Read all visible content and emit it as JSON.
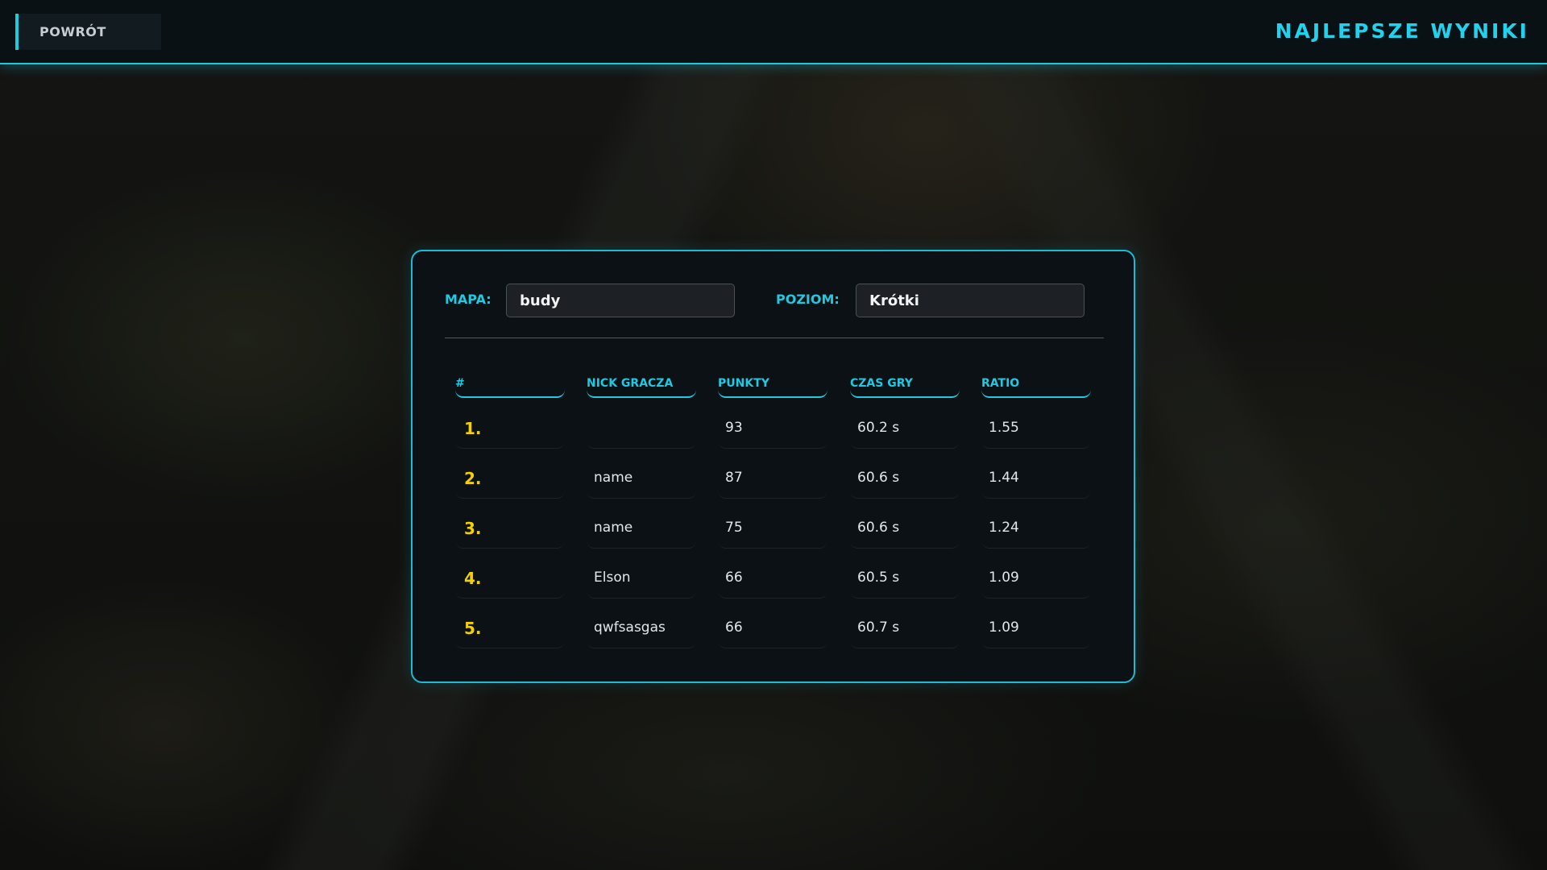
{
  "header": {
    "back_label": "POWRÓT",
    "title": "NAJLEPSZE WYNIKI"
  },
  "filters": {
    "map_label": "MAPA:",
    "map_value": "budy",
    "level_label": "POZIOM:",
    "level_value": "Krótki"
  },
  "table": {
    "columns": [
      "#",
      "NICK GRACZA",
      "PUNKTY",
      "CZAS GRY",
      "RATIO"
    ],
    "rows": [
      {
        "rank": "1.",
        "nick": "",
        "points": "93",
        "time": "60.2 s",
        "ratio": "1.55"
      },
      {
        "rank": "2.",
        "nick": "name",
        "points": "87",
        "time": "60.6 s",
        "ratio": "1.44"
      },
      {
        "rank": "3.",
        "nick": "name",
        "points": "75",
        "time": "60.6 s",
        "ratio": "1.24"
      },
      {
        "rank": "4.",
        "nick": "Elson",
        "points": "66",
        "time": "60.5 s",
        "ratio": "1.09"
      },
      {
        "rank": "5.",
        "nick": "qwfsasgas",
        "points": "66",
        "time": "60.7 s",
        "ratio": "1.09"
      }
    ]
  },
  "colors": {
    "accent": "#1fc9e0",
    "rank": "#f3d000",
    "panel_bg": "#0b1115"
  }
}
